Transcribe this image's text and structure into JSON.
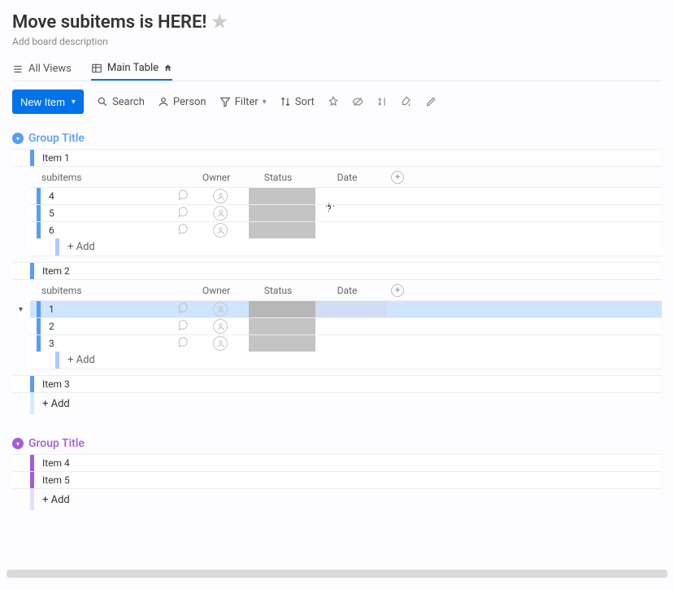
{
  "board": {
    "title": "Move subitems is HERE!",
    "description": "Add board description"
  },
  "tabs": {
    "all_views": "All Views",
    "main_table": "Main Table"
  },
  "toolbar": {
    "new_item": "New Item",
    "search": "Search",
    "person": "Person",
    "filter": "Filter",
    "sort": "Sort"
  },
  "columns": {
    "subitems": "subitems",
    "owner": "Owner",
    "status": "Status",
    "date": "Date"
  },
  "labels": {
    "add": "+ Add"
  },
  "groups": [
    {
      "title": "Group Title",
      "color": "#579bfc",
      "title_text_color": "#579bfc",
      "items": [
        {
          "name": "Item 1",
          "subitems": [
            {
              "name": "4",
              "bar": "#579bfc",
              "selected": false
            },
            {
              "name": "5",
              "bar": "#579bfc",
              "selected": false
            },
            {
              "name": "6",
              "bar": "#579bfc",
              "selected": false
            }
          ]
        },
        {
          "name": "Item 2",
          "subitems": [
            {
              "name": "1",
              "bar": "#579bfc",
              "selected": true
            },
            {
              "name": "2",
              "bar": "#579bfc",
              "selected": false
            },
            {
              "name": "3",
              "bar": "#579bfc",
              "selected": false
            }
          ]
        },
        {
          "name": "Item 3",
          "subitems": []
        }
      ]
    },
    {
      "title": "Group Title",
      "color": "#a25ddc",
      "title_text_color": "#a25ddc",
      "items": [
        {
          "name": "Item 4"
        },
        {
          "name": "Item 5"
        }
      ]
    }
  ]
}
